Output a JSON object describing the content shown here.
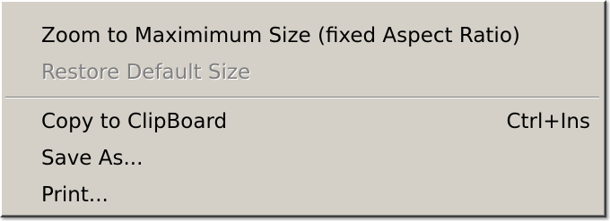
{
  "context_menu": {
    "items": [
      {
        "label": "Zoom to Maximimum Size (fixed Aspect Ratio)",
        "shortcut": "",
        "enabled": true
      },
      {
        "label": "Restore Default Size",
        "shortcut": "",
        "enabled": false
      },
      {
        "label": "Copy to ClipBoard",
        "shortcut": "Ctrl+Ins",
        "enabled": true
      },
      {
        "label": "Save As...",
        "shortcut": "",
        "enabled": true
      },
      {
        "label": "Print...",
        "shortcut": "",
        "enabled": true
      }
    ]
  }
}
